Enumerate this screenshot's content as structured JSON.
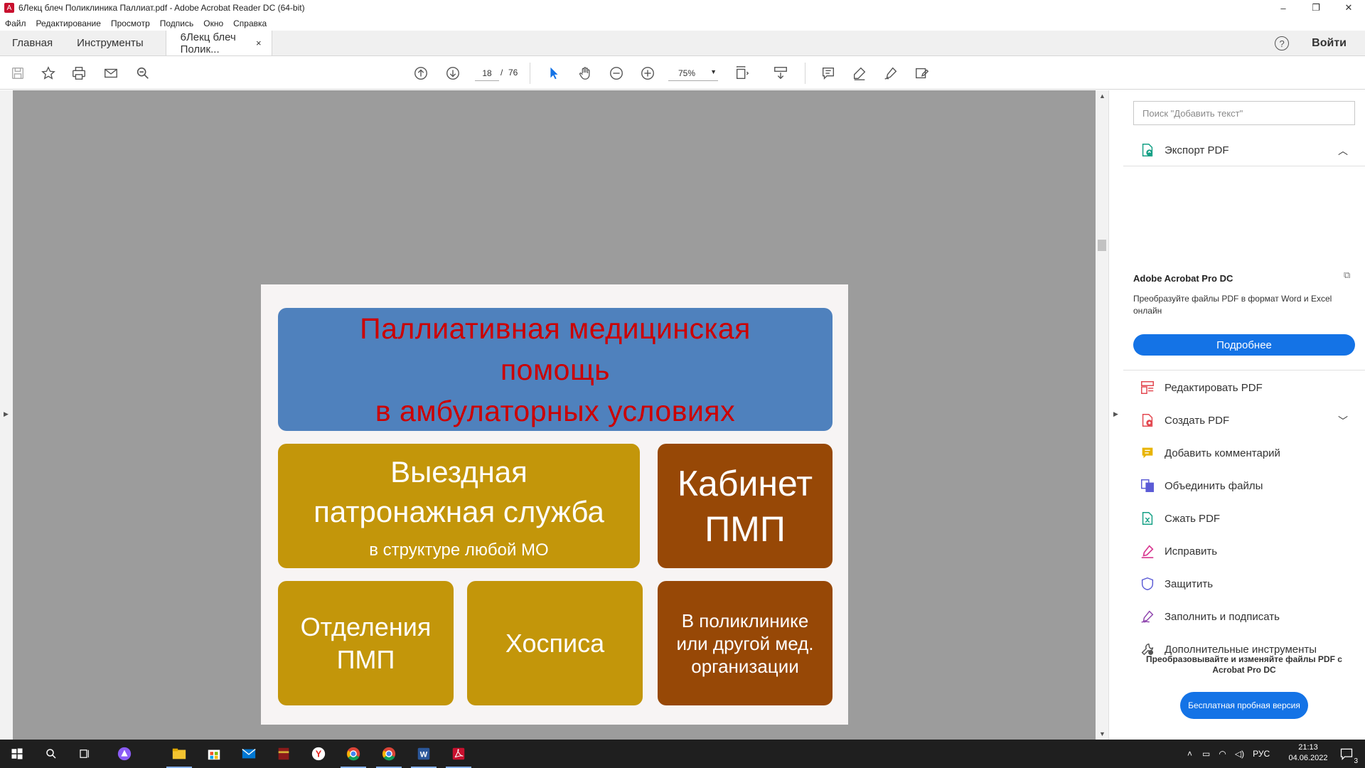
{
  "window": {
    "title": "6Лекц блеч Поликлиника Паллиат.pdf - Adobe Acrobat Reader DC (64-bit)",
    "minimize": "–",
    "maximize": "❐",
    "close": "✕"
  },
  "menu": [
    "Файл",
    "Редактирование",
    "Просмотр",
    "Подпись",
    "Окно",
    "Справка"
  ],
  "tabs": {
    "home": "Главная",
    "tools": "Инструменты",
    "doc": "6Лекц блеч Полик...",
    "doc_close": "×",
    "help": "?",
    "login": "Войти"
  },
  "toolbar": {
    "current_page": "18",
    "page_sep": "/",
    "total_pages": "76",
    "zoom": "75%"
  },
  "slide": {
    "title_line1": "Паллиативная медицинская",
    "title_line2": "помощь",
    "title_line3": "в амбулаторных условиях",
    "box1_line1": "Выездная",
    "box1_line2": "патронажная служба",
    "box1_sub": "в структуре любой МО",
    "box2_line1": "Кабинет",
    "box2_line2": "ПМП",
    "box3_line1": "Отделения",
    "box3_line2": "ПМП",
    "box4": "Хосписа",
    "box5_line1": "В поликлинике",
    "box5_line2": "или другой мед.",
    "box5_line3": "организации"
  },
  "panel": {
    "search_placeholder": "Поиск \"Добавить текст\"",
    "export_pdf": "Экспорт PDF",
    "pro_title": "Adobe Acrobat Pro DC",
    "pro_desc": "Преобразуйте файлы PDF в формат Word и Excel онлайн",
    "pro_button": "Подробнее",
    "tools": [
      {
        "label": "Редактировать PDF",
        "icon": "edit-pdf-icon",
        "color": "#e34850"
      },
      {
        "label": "Создать PDF",
        "icon": "create-pdf-icon",
        "color": "#e34850"
      },
      {
        "label": "Добавить комментарий",
        "icon": "comment-icon",
        "color": "#e8b400"
      },
      {
        "label": "Объединить файлы",
        "icon": "combine-files-icon",
        "color": "#5b5bd6"
      },
      {
        "label": "Сжать PDF",
        "icon": "compress-pdf-icon",
        "color": "#14a085"
      },
      {
        "label": "Исправить",
        "icon": "redact-icon",
        "color": "#d83790"
      },
      {
        "label": "Защитить",
        "icon": "protect-icon",
        "color": "#5b5bd6"
      },
      {
        "label": "Заполнить и подписать",
        "icon": "fill-sign-icon",
        "color": "#8e44ad"
      },
      {
        "label": "Дополнительные инструменты",
        "icon": "more-tools-icon",
        "color": "#555555"
      }
    ],
    "promo": "Преобразовывайте и изменяйте файлы PDF с Acrobat Pro DC",
    "trial_button": "Бесплатная пробная версия"
  },
  "taskbar": {
    "lang": "РУС",
    "time": "21:13",
    "date": "04.06.2022",
    "notifications": "3"
  },
  "colors": {
    "accent": "#1473e6",
    "slide_blue": "#4f81bd",
    "slide_gold": "#c3960a",
    "slide_brown": "#974806",
    "slide_title_text": "#cc0000"
  }
}
